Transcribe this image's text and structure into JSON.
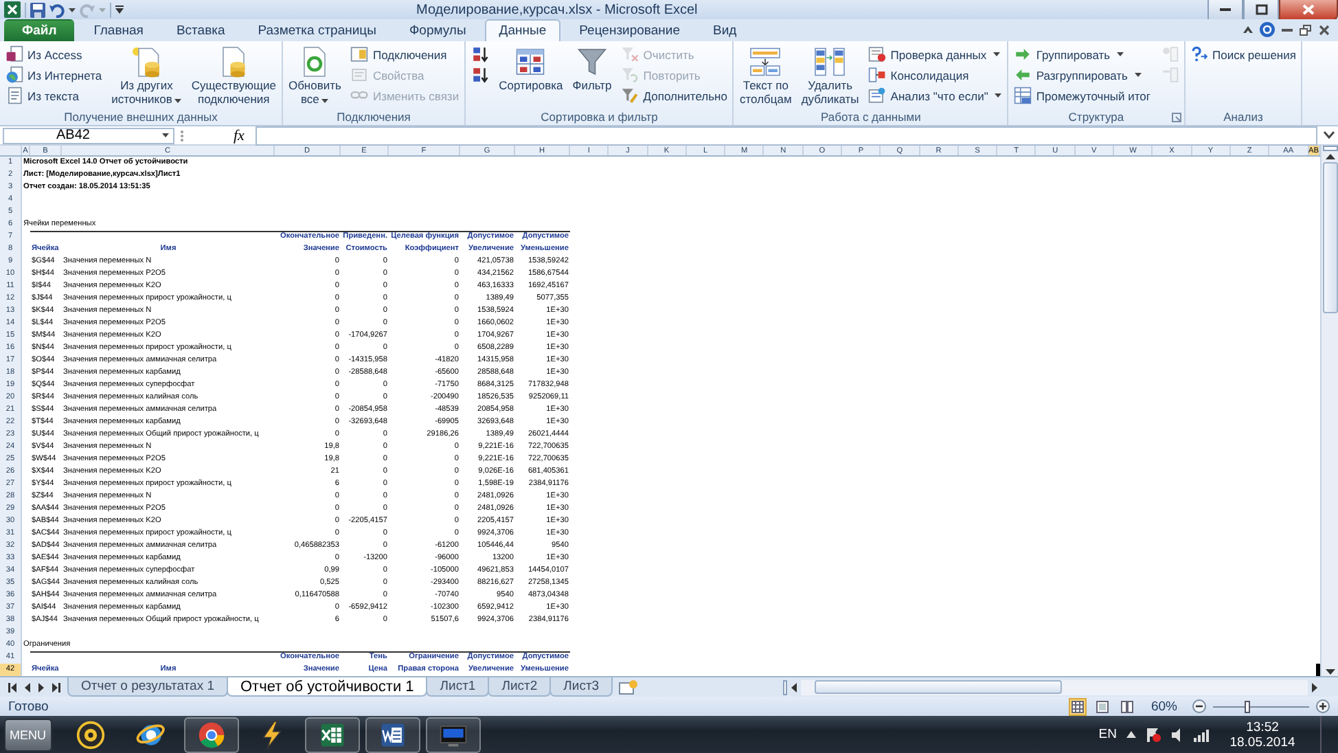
{
  "window": {
    "title": "Моделирование,курсач.xlsx - Microsoft Excel"
  },
  "ribbon_tabs": [
    {
      "label": "Файл",
      "kind": "file",
      "selected": false
    },
    {
      "label": "Главная",
      "kind": "tab",
      "selected": false
    },
    {
      "label": "Вставка",
      "kind": "tab",
      "selected": false
    },
    {
      "label": "Разметка страницы",
      "kind": "tab",
      "selected": false
    },
    {
      "label": "Формулы",
      "kind": "tab",
      "selected": false
    },
    {
      "label": "Данные",
      "kind": "tab",
      "selected": true
    },
    {
      "label": "Рецензирование",
      "kind": "tab",
      "selected": false
    },
    {
      "label": "Вид",
      "kind": "tab",
      "selected": false
    }
  ],
  "ribbon_groups": [
    {
      "label": "Получение внешних данных",
      "columns": [
        {
          "kind": "stack",
          "items": [
            {
              "kind": "small",
              "label": "Из Access",
              "disabled": false
            },
            {
              "kind": "small",
              "label": "Из Интернета",
              "disabled": false
            },
            {
              "kind": "small",
              "label": "Из текста",
              "disabled": false
            }
          ]
        },
        {
          "kind": "large",
          "lines": [
            "Из других",
            "источников"
          ],
          "disabled": false,
          "dropdown": true
        },
        {
          "kind": "large",
          "lines": [
            "Существующие",
            "подключения"
          ],
          "disabled": false
        }
      ]
    },
    {
      "label": "Подключения",
      "columns": [
        {
          "kind": "large",
          "lines": [
            "Обновить",
            "все"
          ],
          "disabled": false,
          "dropdown": true
        },
        {
          "kind": "stack",
          "items": [
            {
              "kind": "small",
              "label": "Подключения",
              "disabled": false
            },
            {
              "kind": "small",
              "label": "Свойства",
              "disabled": true
            },
            {
              "kind": "small",
              "label": "Изменить связи",
              "disabled": true
            }
          ]
        }
      ]
    },
    {
      "label": "Сортировка и фильтр",
      "columns": [
        {
          "kind": "stack",
          "items": [
            {
              "kind": "icon",
              "disabled": false
            },
            {
              "kind": "icon",
              "disabled": false
            }
          ]
        },
        {
          "kind": "large",
          "lines": [
            "Сортировка"
          ],
          "disabled": false
        },
        {
          "kind": "large",
          "lines": [
            "Фильтр"
          ],
          "disabled": false
        },
        {
          "kind": "stack",
          "items": [
            {
              "kind": "small",
              "label": "Очистить",
              "disabled": true
            },
            {
              "kind": "small",
              "label": "Повторить",
              "disabled": true
            },
            {
              "kind": "small",
              "label": "Дополнительно",
              "disabled": false
            }
          ]
        }
      ]
    },
    {
      "label": "Работа с данными",
      "columns": [
        {
          "kind": "large",
          "lines": [
            "Текст по",
            "столбцам"
          ],
          "disabled": false
        },
        {
          "kind": "large",
          "lines": [
            "Удалить",
            "дубликаты"
          ],
          "disabled": false
        },
        {
          "kind": "stack",
          "items": [
            {
              "kind": "small",
              "label": "Проверка данных",
              "disabled": false,
              "dropdown": true
            },
            {
              "kind": "small",
              "label": "Консолидация",
              "disabled": false
            },
            {
              "kind": "small",
              "label": "Анализ \"что если\"",
              "disabled": false,
              "dropdown": true
            }
          ]
        }
      ]
    },
    {
      "label": "Структура",
      "launcher": true,
      "columns": [
        {
          "kind": "stack",
          "items": [
            {
              "kind": "small",
              "label": "Группировать",
              "disabled": false,
              "dropdown": true
            },
            {
              "kind": "small",
              "label": "Разгруппировать",
              "disabled": false,
              "dropdown": true
            },
            {
              "kind": "small",
              "label": "Промежуточный итог",
              "disabled": false
            }
          ]
        },
        {
          "kind": "stack",
          "items": [
            {
              "kind": "icon",
              "disabled": true
            },
            {
              "kind": "icon",
              "disabled": true
            }
          ]
        }
      ]
    },
    {
      "label": "Анализ",
      "columns": [
        {
          "kind": "stack",
          "items": [
            {
              "kind": "small",
              "label": "Поиск решения",
              "disabled": false
            }
          ]
        }
      ]
    }
  ],
  "formula_bar": {
    "name_box": "AB42",
    "function_label": "fx"
  },
  "sheet": {
    "columns": [
      {
        "label": "A",
        "selected": false
      },
      {
        "label": "B",
        "selected": false
      },
      {
        "label": "C",
        "selected": false
      },
      {
        "label": "D",
        "selected": false
      },
      {
        "label": "E",
        "selected": false
      },
      {
        "label": "F",
        "selected": false
      },
      {
        "label": "G",
        "selected": false
      },
      {
        "label": "H",
        "selected": false
      },
      {
        "label": "I",
        "selected": false
      },
      {
        "label": "J",
        "selected": false
      },
      {
        "label": "K",
        "selected": false
      },
      {
        "label": "L",
        "selected": false
      },
      {
        "label": "M",
        "selected": false
      },
      {
        "label": "N",
        "selected": false
      },
      {
        "label": "O",
        "selected": false
      },
      {
        "label": "P",
        "selected": false
      },
      {
        "label": "Q",
        "selected": false
      },
      {
        "label": "R",
        "selected": false
      },
      {
        "label": "S",
        "selected": false
      },
      {
        "label": "T",
        "selected": false
      },
      {
        "label": "U",
        "selected": false
      },
      {
        "label": "V",
        "selected": false
      },
      {
        "label": "W",
        "selected": false
      },
      {
        "label": "X",
        "selected": false
      },
      {
        "label": "Y",
        "selected": false
      },
      {
        "label": "Z",
        "selected": false
      },
      {
        "label": "AA",
        "selected": false
      },
      {
        "label": "AB",
        "selected": true
      }
    ],
    "rows": [
      {
        "number": "1",
        "selected": false,
        "kind": "title",
        "text": "Microsoft Excel 14.0 Отчет об устойчивости"
      },
      {
        "number": "2",
        "selected": false,
        "kind": "title",
        "text": "Лист: [Моделирование,курсач.xlsx]Лист1"
      },
      {
        "number": "3",
        "selected": false,
        "kind": "title",
        "text": "Отчет создан: 18.05.2014 13:51:35"
      },
      {
        "number": "4",
        "selected": false,
        "kind": "empty"
      },
      {
        "number": "5",
        "selected": false,
        "kind": "empty"
      },
      {
        "number": "6",
        "selected": false,
        "kind": "section",
        "text": "Ячейки переменных"
      },
      {
        "number": "7",
        "selected": false,
        "kind": "header_upper",
        "cells": [
          "Окончательное",
          "Приведенн.",
          "Целевая функция",
          "Допустимое",
          "Допустимое"
        ]
      },
      {
        "number": "8",
        "selected": false,
        "kind": "header_lower",
        "cells": [
          "Ячейка",
          "Имя",
          "Значение",
          "Стоимость",
          "Коэффициент",
          "Увеличение",
          "Уменьшение"
        ]
      },
      {
        "number": "9",
        "selected": false,
        "kind": "data",
        "cells": [
          "$G$44",
          "Значения переменных N",
          "0",
          "0",
          "0",
          "421,05738",
          "1538,59242"
        ]
      },
      {
        "number": "10",
        "selected": false,
        "kind": "data",
        "cells": [
          "$H$44",
          "Значения переменных P2O5",
          "0",
          "0",
          "0",
          "434,21562",
          "1586,67544"
        ]
      },
      {
        "number": "11",
        "selected": false,
        "kind": "data",
        "cells": [
          "$I$44",
          "Значения переменных K2O",
          "0",
          "0",
          "0",
          "463,16333",
          "1692,45167"
        ]
      },
      {
        "number": "12",
        "selected": false,
        "kind": "data",
        "cells": [
          "$J$44",
          "Значения переменных прирост урожайности, ц",
          "0",
          "0",
          "0",
          "1389,49",
          "5077,355"
        ]
      },
      {
        "number": "13",
        "selected": false,
        "kind": "data",
        "cells": [
          "$K$44",
          "Значения переменных N",
          "0",
          "0",
          "0",
          "1538,5924",
          "1E+30"
        ]
      },
      {
        "number": "14",
        "selected": false,
        "kind": "data",
        "cells": [
          "$L$44",
          "Значения переменных P2O5",
          "0",
          "0",
          "0",
          "1660,0602",
          "1E+30"
        ]
      },
      {
        "number": "15",
        "selected": false,
        "kind": "data",
        "cells": [
          "$M$44",
          "Значения переменных K2O",
          "0",
          "-1704,9267",
          "0",
          "1704,9267",
          "1E+30"
        ]
      },
      {
        "number": "16",
        "selected": false,
        "kind": "data",
        "cells": [
          "$N$44",
          "Значения переменных прирост урожайности, ц",
          "0",
          "0",
          "0",
          "6508,2289",
          "1E+30"
        ]
      },
      {
        "number": "17",
        "selected": false,
        "kind": "data",
        "cells": [
          "$O$44",
          "Значения переменных аммиачная селитра",
          "0",
          "-14315,958",
          "-41820",
          "14315,958",
          "1E+30"
        ]
      },
      {
        "number": "18",
        "selected": false,
        "kind": "data",
        "cells": [
          "$P$44",
          "Значения переменных карбамид",
          "0",
          "-28588,648",
          "-65600",
          "28588,648",
          "1E+30"
        ]
      },
      {
        "number": "19",
        "selected": false,
        "kind": "data",
        "cells": [
          "$Q$44",
          "Значения переменных суперфосфат",
          "0",
          "0",
          "-71750",
          "8684,3125",
          "717832,948"
        ]
      },
      {
        "number": "20",
        "selected": false,
        "kind": "data",
        "cells": [
          "$R$44",
          "Значения переменных калийная соль",
          "0",
          "0",
          "-200490",
          "18526,535",
          "9252069,11"
        ]
      },
      {
        "number": "21",
        "selected": false,
        "kind": "data",
        "cells": [
          "$S$44",
          "Значения переменных аммиачная селитра",
          "0",
          "-20854,958",
          "-48539",
          "20854,958",
          "1E+30"
        ]
      },
      {
        "number": "22",
        "selected": false,
        "kind": "data",
        "cells": [
          "$T$44",
          "Значения переменных карбамид",
          "0",
          "-32693,648",
          "-69905",
          "32693,648",
          "1E+30"
        ]
      },
      {
        "number": "23",
        "selected": false,
        "kind": "data",
        "cells": [
          "$U$44",
          "Значения переменных Общий прирост урожайности, ц",
          "0",
          "0",
          "29186,26",
          "1389,49",
          "26021,4444"
        ]
      },
      {
        "number": "24",
        "selected": false,
        "kind": "data",
        "cells": [
          "$V$44",
          "Значения переменных N",
          "19,8",
          "0",
          "0",
          "9,221E-16",
          "722,700635"
        ]
      },
      {
        "number": "25",
        "selected": false,
        "kind": "data",
        "cells": [
          "$W$44",
          "Значения переменных P2O5",
          "19,8",
          "0",
          "0",
          "9,221E-16",
          "722,700635"
        ]
      },
      {
        "number": "26",
        "selected": false,
        "kind": "data",
        "cells": [
          "$X$44",
          "Значения переменных K2O",
          "21",
          "0",
          "0",
          "9,026E-16",
          "681,405361"
        ]
      },
      {
        "number": "27",
        "selected": false,
        "kind": "data",
        "cells": [
          "$Y$44",
          "Значения переменных прирост урожайности, ц",
          "6",
          "0",
          "0",
          "1,598E-19",
          "2384,91176"
        ]
      },
      {
        "number": "28",
        "selected": false,
        "kind": "data",
        "cells": [
          "$Z$44",
          "Значения переменных N",
          "0",
          "0",
          "0",
          "2481,0926",
          "1E+30"
        ]
      },
      {
        "number": "29",
        "selected": false,
        "kind": "data",
        "cells": [
          "$AA$44",
          "Значения переменных P2O5",
          "0",
          "0",
          "0",
          "2481,0926",
          "1E+30"
        ]
      },
      {
        "number": "30",
        "selected": false,
        "kind": "data",
        "cells": [
          "$AB$44",
          "Значения переменных K2O",
          "0",
          "-2205,4157",
          "0",
          "2205,4157",
          "1E+30"
        ]
      },
      {
        "number": "31",
        "selected": false,
        "kind": "data",
        "cells": [
          "$AC$44",
          "Значения переменных прирост урожайности, ц",
          "0",
          "0",
          "0",
          "9924,3706",
          "1E+30"
        ]
      },
      {
        "number": "32",
        "selected": false,
        "kind": "data",
        "cells": [
          "$AD$44",
          "Значения переменных аммиачная селитра",
          "0,465882353",
          "0",
          "-61200",
          "105446,44",
          "9540"
        ]
      },
      {
        "number": "33",
        "selected": false,
        "kind": "data",
        "cells": [
          "$AE$44",
          "Значения переменных карбамид",
          "0",
          "-13200",
          "-96000",
          "13200",
          "1E+30"
        ]
      },
      {
        "number": "34",
        "selected": false,
        "kind": "data",
        "cells": [
          "$AF$44",
          "Значения переменных суперфосфат",
          "0,99",
          "0",
          "-105000",
          "49621,853",
          "14454,0107"
        ]
      },
      {
        "number": "35",
        "selected": false,
        "kind": "data",
        "cells": [
          "$AG$44",
          "Значения переменных калийная соль",
          "0,525",
          "0",
          "-293400",
          "88216,627",
          "27258,1345"
        ]
      },
      {
        "number": "36",
        "selected": false,
        "kind": "data",
        "cells": [
          "$AH$44",
          "Значения переменных аммиачная селитра",
          "0,116470588",
          "0",
          "-70740",
          "9540",
          "4873,04348"
        ]
      },
      {
        "number": "37",
        "selected": false,
        "kind": "data",
        "cells": [
          "$AI$44",
          "Значения переменных карбамид",
          "0",
          "-6592,9412",
          "-102300",
          "6592,9412",
          "1E+30"
        ]
      },
      {
        "number": "38",
        "selected": false,
        "kind": "data",
        "cells": [
          "$AJ$44",
          "Значения переменных Общий прирост урожайности, ц",
          "6",
          "0",
          "51507,6",
          "9924,3706",
          "2384,91176"
        ]
      },
      {
        "number": "39",
        "selected": false,
        "kind": "empty"
      },
      {
        "number": "40",
        "selected": false,
        "kind": "section",
        "text": "Ограничения"
      },
      {
        "number": "41",
        "selected": false,
        "kind": "header_upper",
        "cells": [
          "Окончательное",
          "Тень",
          "Ограничение",
          "Допустимое",
          "Допустимое"
        ]
      },
      {
        "number": "42",
        "selected": true,
        "kind": "header_lower",
        "cells": [
          "Ячейка",
          "Имя",
          "Значение",
          "Цена",
          "Правая сторона",
          "Увеличение",
          "Уменьшение"
        ]
      }
    ]
  },
  "sheet_tabs": [
    {
      "label": "Отчет о результатах 1",
      "selected": false
    },
    {
      "label": "Отчет об устойчивости 1",
      "selected": true
    },
    {
      "label": "Лист1",
      "selected": false
    },
    {
      "label": "Лист2",
      "selected": false
    },
    {
      "label": "Лист3",
      "selected": false
    }
  ],
  "status_bar": {
    "text": "Готово",
    "views": [
      {
        "selected": true
      },
      {
        "selected": false
      },
      {
        "selected": false
      }
    ],
    "zoom": "60%",
    "zoom_slider": {
      "level": 0.37
    }
  },
  "taskbar": {
    "menu_label": "MENU",
    "apps": [
      {
        "running": false
      },
      {
        "running": false
      },
      {
        "running": true
      },
      {
        "running": false
      },
      {
        "running": true
      },
      {
        "running": true
      },
      {
        "running": true
      }
    ],
    "language": "EN",
    "time": "13:52",
    "date": "18.05.2014"
  }
}
